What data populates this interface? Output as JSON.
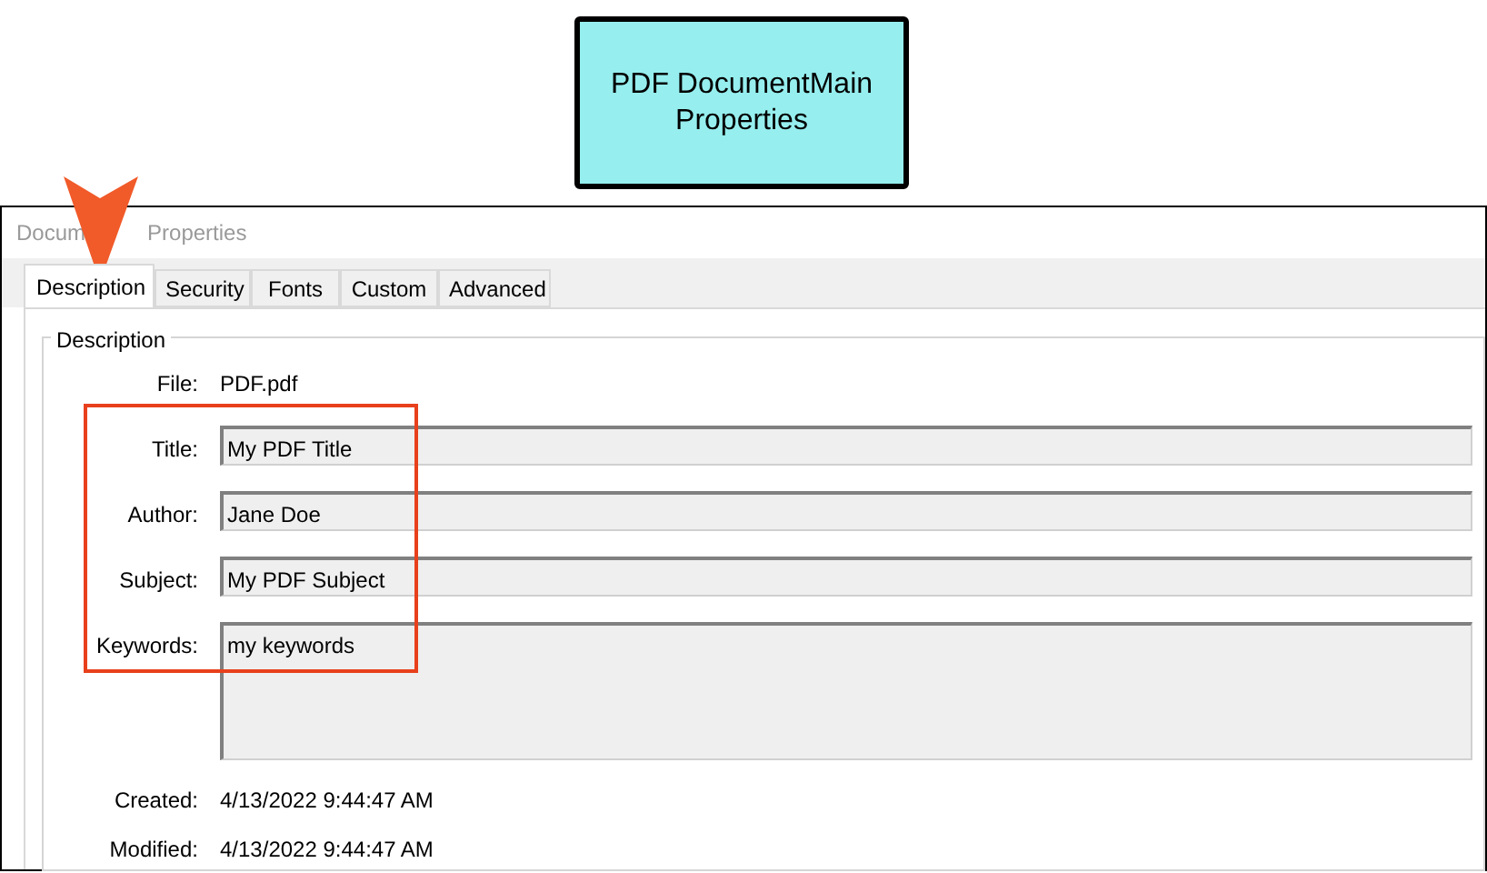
{
  "callout": {
    "lines": [
      "PDF DocumentMain",
      "Properties"
    ]
  },
  "window": {
    "title_parts": [
      "Docum",
      "Properties"
    ]
  },
  "tabs": [
    {
      "label": "Description",
      "selected": true
    },
    {
      "label": "Security",
      "selected": false
    },
    {
      "label": "Fonts",
      "selected": false
    },
    {
      "label": "Custom",
      "selected": false
    },
    {
      "label": "Advanced",
      "selected": false
    }
  ],
  "group": {
    "title": "Description"
  },
  "file": {
    "label": "File:",
    "value": "PDF.pdf"
  },
  "fields": [
    {
      "label": "Title:",
      "value": "My PDF Title",
      "kind": "line"
    },
    {
      "label": "Author:",
      "value": "Jane Doe",
      "kind": "line"
    },
    {
      "label": "Subject:",
      "value": "My PDF Subject",
      "kind": "line"
    },
    {
      "label": "Keywords:",
      "value": "my keywords",
      "kind": "area"
    }
  ],
  "dates": [
    {
      "label": "Created:",
      "value": "4/13/2022 9:44:47 AM"
    },
    {
      "label": "Modified:",
      "value": "4/13/2022 9:44:47 AM"
    }
  ]
}
